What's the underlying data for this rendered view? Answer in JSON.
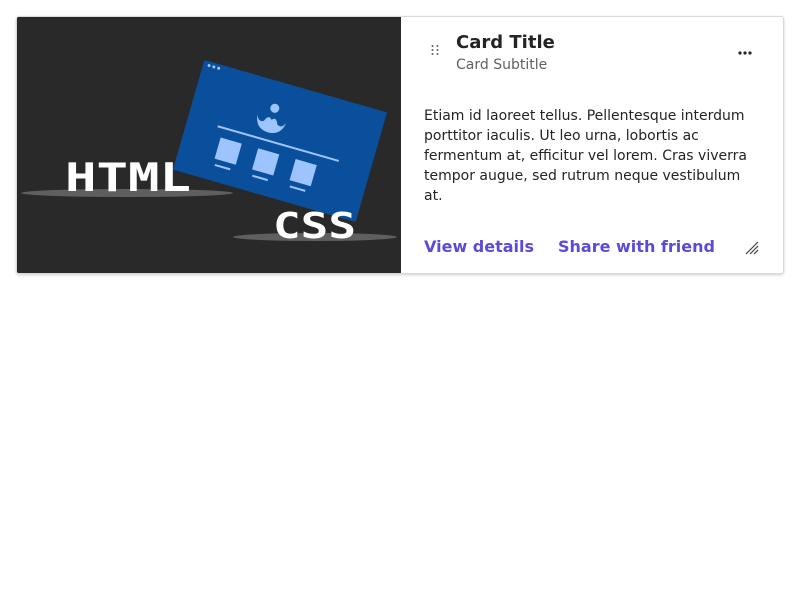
{
  "card": {
    "title": "Card Title",
    "subtitle": "Card Subtitle",
    "body_text": "Etiam id laoreet tellus. Pellentesque interdum porttitor iaculis. Ut leo urna, lobortis ac fermentum at, efficitur vel lorem. Cras viverra tempor augue, sed rutrum neque vestibulum at.",
    "image": {
      "html_label": "HTML",
      "css_label": "CSS",
      "background_color": "#292929",
      "browser_color": "#0a4f9c"
    },
    "actions": {
      "view_details": "View details",
      "share_with_friend": "Share with friend"
    },
    "icons": {
      "drag": "drag-handle-icon",
      "more": "more-horizontal-icon",
      "resize": "resize-corner-icon"
    },
    "accent_color": "#5b4bd8"
  }
}
